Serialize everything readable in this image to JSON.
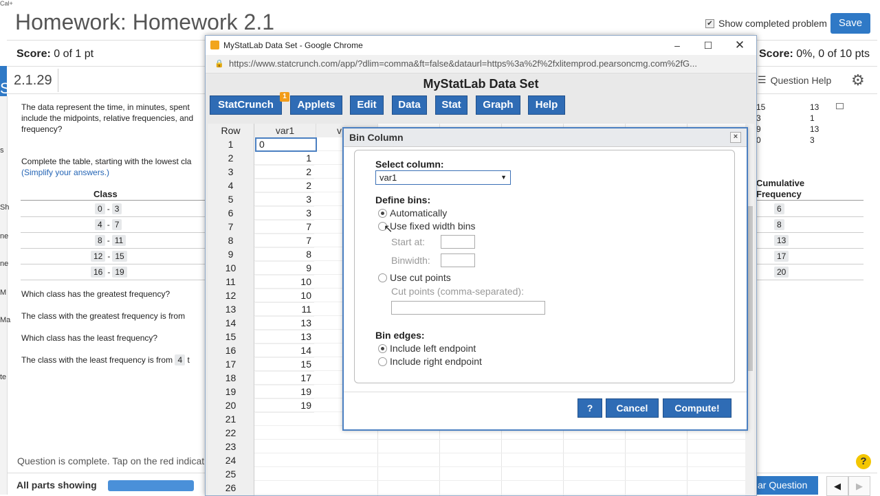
{
  "homework": {
    "title": "Homework: Homework 2.1",
    "score_left_label": "Score:",
    "score_left_value": "0 of 1 pt",
    "score_right_label": "Score:",
    "score_right_value": "0%, 0 of 10 pts",
    "show_completed": "Show completed problem",
    "save": "Save",
    "question_number": "2.1.29",
    "question_help": "Question Help",
    "intro_text": [
      "The data represent the time, in minutes, spent",
      "include the midpoints, relative frequencies, and",
      "frequency?"
    ],
    "instruction": "Complete the table, starting with the lowest cla",
    "simplify": "(Simplify your answers.)",
    "class_header": "Class",
    "classes": [
      {
        "low": "0",
        "high": "3"
      },
      {
        "low": "4",
        "high": "7"
      },
      {
        "low": "8",
        "high": "11"
      },
      {
        "low": "12",
        "high": "15"
      },
      {
        "low": "16",
        "high": "19"
      }
    ],
    "q_greatest": "Which class has the greatest frequency?",
    "a_greatest": "The class with the greatest frequency is from",
    "q_least": "Which class has the least frequency?",
    "a_least_prefix": "The class with the least frequency is from",
    "a_least_value": "4",
    "a_least_suffix": "t",
    "top_table_values": [
      [
        "15",
        "13"
      ],
      [
        "3",
        "1"
      ],
      [
        "9",
        "13"
      ],
      [
        "0",
        "3"
      ]
    ],
    "cumulative_header_1": "Cumulative",
    "cumulative_header_2": "Frequency",
    "cumulative_values": [
      "6",
      "8",
      "13",
      "17",
      "20"
    ],
    "complete_text": "Question is complete. Tap on the red indicat",
    "parts_showing": "All parts showing",
    "clear_question": "ar Question",
    "strip_labels": [
      "Cal+",
      "S",
      "s",
      "Sh",
      "ne",
      "ne",
      "M",
      "Ma",
      "te"
    ]
  },
  "browser": {
    "window_title": "MyStatLab Data Set - Google Chrome",
    "url": "https://www.statcrunch.com/app/?dlim=comma&ft=false&dataurl=https%3a%2f%2fxlitemprod.pearsoncmg.com%2fG..."
  },
  "app": {
    "title": "MyStatLab Data Set",
    "menu": [
      "StatCrunch",
      "Applets",
      "Edit",
      "Data",
      "Stat",
      "Graph",
      "Help"
    ],
    "badge": "1",
    "grid_header_row": "Row",
    "grid_header_var": "var1",
    "grid_header_next": "v",
    "rows": [
      "1",
      "2",
      "3",
      "4",
      "5",
      "6",
      "7",
      "8",
      "9",
      "10",
      "11",
      "12",
      "13",
      "14",
      "15",
      "16",
      "17",
      "18",
      "19",
      "20",
      "21",
      "22",
      "23",
      "24",
      "25",
      "26"
    ],
    "var1": [
      "0",
      "1",
      "2",
      "2",
      "3",
      "3",
      "7",
      "7",
      "8",
      "9",
      "10",
      "10",
      "11",
      "13",
      "13",
      "14",
      "15",
      "17",
      "19",
      "19"
    ]
  },
  "dialog": {
    "title": "Bin Column",
    "close": "×",
    "select_column_label": "Select column:",
    "select_column_value": "var1",
    "define_bins_label": "Define bins:",
    "automatically": "Automatically",
    "fixed_width": "Use fixed width bins",
    "start_at": "Start at:",
    "binwidth": "Binwidth:",
    "cut_points": "Use cut points",
    "cut_points_label": "Cut points (comma-separated):",
    "bin_edges_label": "Bin edges:",
    "include_left": "Include left endpoint",
    "include_right": "Include right endpoint",
    "help_btn": "?",
    "cancel_btn": "Cancel",
    "compute_btn": "Compute!"
  }
}
